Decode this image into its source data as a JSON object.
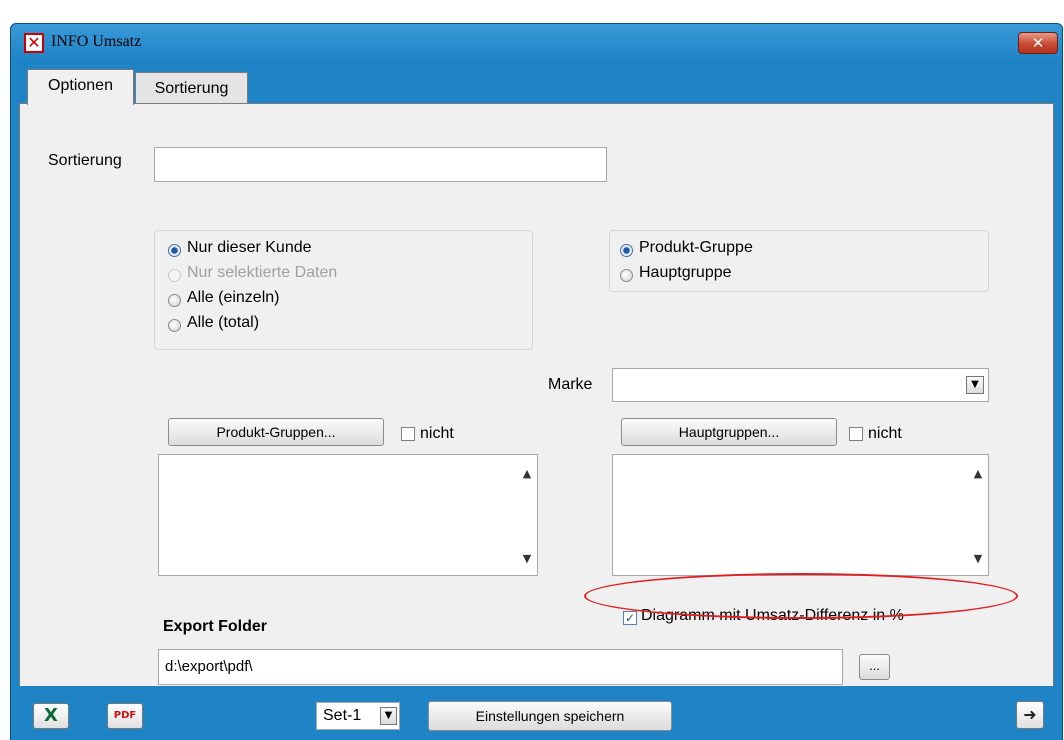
{
  "window": {
    "title": "INFO Umsatz",
    "close_glyph": "✕",
    "app_icon": "x-icon"
  },
  "tabs": [
    {
      "label": "Optionen"
    },
    {
      "label": "Sortierung"
    }
  ],
  "sortierung": {
    "label": "Sortierung",
    "value": ""
  },
  "scope_group": {
    "options": [
      {
        "label": "Nur dieser Kunde",
        "selected": true,
        "enabled": true
      },
      {
        "label": "Nur selektierte Daten",
        "selected": false,
        "enabled": false
      },
      {
        "label": "Alle (einzeln)",
        "selected": false,
        "enabled": true
      },
      {
        "label": "Alle (total)",
        "selected": false,
        "enabled": true
      }
    ]
  },
  "group_type": {
    "options": [
      {
        "label": "Produkt-Gruppe",
        "selected": true
      },
      {
        "label": "Hauptgruppe",
        "selected": false
      }
    ]
  },
  "marke": {
    "label": "Marke",
    "value": ""
  },
  "produkt_gruppen": {
    "button_label": "Produkt-Gruppen...",
    "nicht_label": "nicht",
    "nicht_checked": false
  },
  "hauptgruppen": {
    "button_label": "Hauptgruppen...",
    "nicht_label": "nicht",
    "nicht_checked": false
  },
  "diagramm": {
    "label": "Diagramm mit Umsatz-Differenz in %",
    "checked": true
  },
  "export": {
    "label": "Export Folder",
    "path": "d:\\export\\pdf\\",
    "browse_label": "..."
  },
  "bottom": {
    "set_value": "Set-1",
    "save_label": "Einstellungen speichern",
    "excel_glyph": "X",
    "pdf_glyph": "PDF",
    "exit_glyph": "➜"
  },
  "colors": {
    "frame": "#1f84c6",
    "client": "#f0f0f0",
    "highlight": "#e02020"
  }
}
